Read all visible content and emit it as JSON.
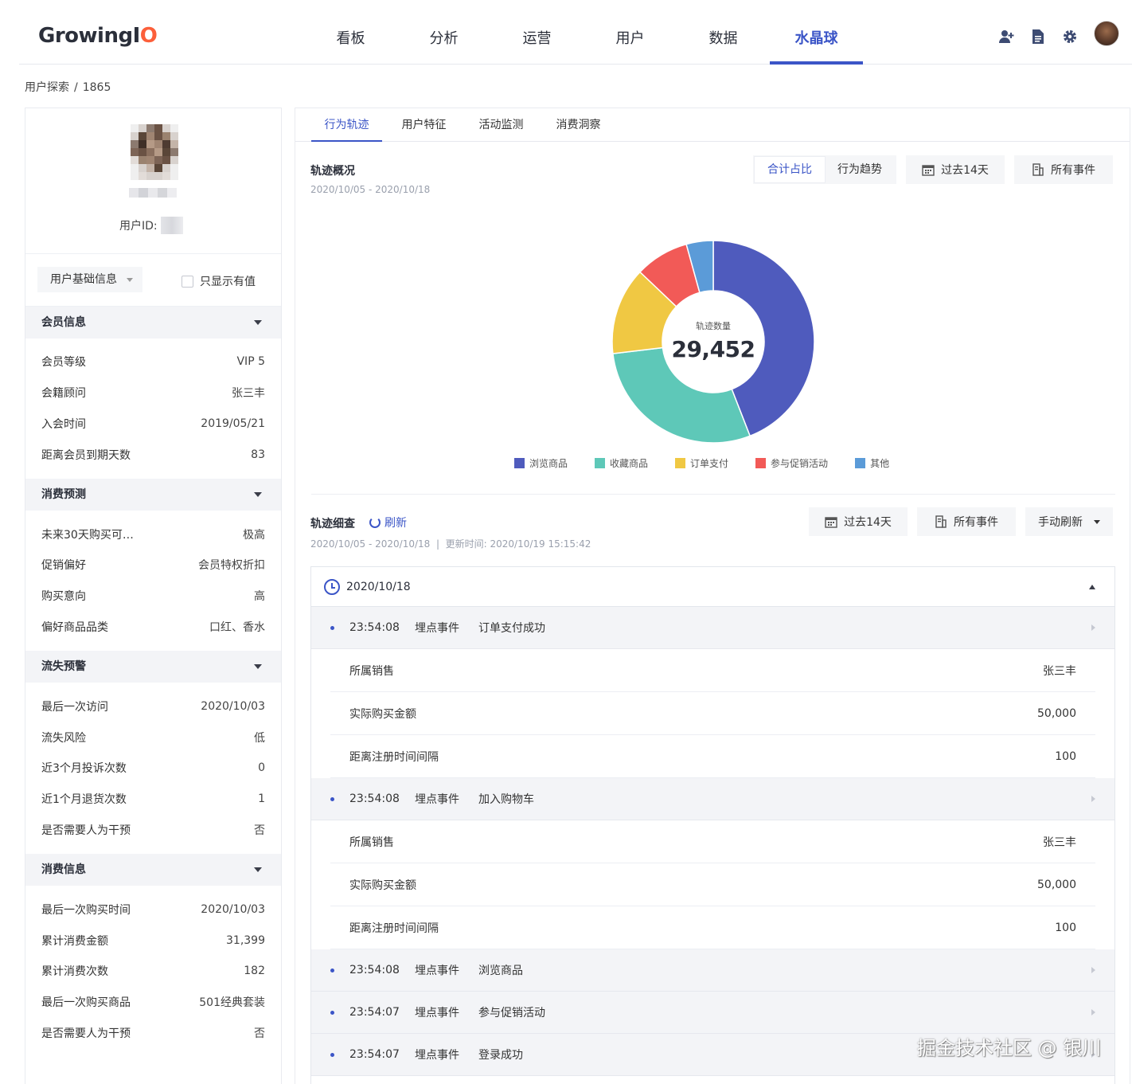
{
  "logo": {
    "prefix": "GrowingI",
    "suffix": "O"
  },
  "nav": [
    "看板",
    "分析",
    "运营",
    "用户",
    "数据",
    "水晶球"
  ],
  "nav_active": "水晶球",
  "breadcrumb": {
    "root": "用户探索",
    "sep": "/",
    "current": "1865"
  },
  "profile": {
    "uid_label": "用户ID:"
  },
  "filter": {
    "select_label": "用户基础信息",
    "checkbox_label": "只显示有值"
  },
  "sections": [
    {
      "title": "会员信息",
      "rows": [
        [
          "会员等级",
          "VIP 5"
        ],
        [
          "会籍顾问",
          "张三丰"
        ],
        [
          "入会时间",
          "2019/05/21"
        ],
        [
          "距离会员到期天数",
          "83"
        ]
      ]
    },
    {
      "title": "消费预测",
      "rows": [
        [
          "未来30天购买可…",
          "极高"
        ],
        [
          "促销偏好",
          "会员特权折扣"
        ],
        [
          "购买意向",
          "高"
        ],
        [
          "偏好商品品类",
          "口红、香水"
        ]
      ]
    },
    {
      "title": "流失预警",
      "rows": [
        [
          "最后一次访问",
          "2020/10/03"
        ],
        [
          "流失风险",
          "低"
        ],
        [
          "近3个月投诉次数",
          "0"
        ],
        [
          "近1个月退货次数",
          "1"
        ],
        [
          "是否需要人为干预",
          "否"
        ]
      ]
    },
    {
      "title": "消费信息",
      "rows": [
        [
          "最后一次购买时间",
          "2020/10/03"
        ],
        [
          "累计消费金额",
          "31,399"
        ],
        [
          "累计消费次数",
          "182"
        ],
        [
          "最后一次购买商品",
          "501经典套装"
        ],
        [
          "是否需要人为干预",
          "否"
        ]
      ]
    }
  ],
  "tabs": [
    "行为轨迹",
    "用户特征",
    "活动监测",
    "消费洞察"
  ],
  "overview": {
    "title": "轨迹概况",
    "date": "2020/10/05 - 2020/10/18",
    "seg": [
      "合计占比",
      "行为趋势"
    ],
    "range_btn": "过去14天",
    "events_btn": "所有事件",
    "center_label": "轨迹数量",
    "center_value": "29,452"
  },
  "chart_data": {
    "type": "pie",
    "donut": true,
    "center_label": "轨迹数量",
    "center_value": "29,452",
    "series": [
      {
        "name": "浏览商品",
        "value": 41,
        "color": "#4f5bbd"
      },
      {
        "name": "收藏商品",
        "value": 27,
        "color": "#5ec8b8"
      },
      {
        "name": "订单支付",
        "value": 13,
        "color": "#f0c843"
      },
      {
        "name": "参与促销活动",
        "value": 8,
        "color": "#f25a57"
      },
      {
        "name": "其他",
        "value": 4,
        "color": "#5b9bd8"
      }
    ]
  },
  "detail": {
    "title": "轨迹细查",
    "refresh": "刷新",
    "date": "2020/10/05 - 2020/10/18",
    "sep": "|",
    "updated": "更新时间: 2020/10/19 15:15:42",
    "range_btn": "过去14天",
    "events_btn": "所有事件",
    "manual_btn": "手动刷新",
    "day": "2020/10/18",
    "events": [
      {
        "time": "23:54:08",
        "kind": "埋点事件",
        "name": "订单支付成功",
        "props": [
          [
            "所属销售",
            "张三丰"
          ],
          [
            "实际购买金额",
            "50,000"
          ],
          [
            "距离注册时间间隔",
            "100"
          ]
        ]
      },
      {
        "time": "23:54:08",
        "kind": "埋点事件",
        "name": "加入购物车",
        "props": [
          [
            "所属销售",
            "张三丰"
          ],
          [
            "实际购买金额",
            "50,000"
          ],
          [
            "距离注册时间间隔",
            "100"
          ]
        ]
      },
      {
        "time": "23:54:08",
        "kind": "埋点事件",
        "name": "浏览商品",
        "props": []
      },
      {
        "time": "23:54:07",
        "kind": "埋点事件",
        "name": "参与促销活动",
        "props": []
      },
      {
        "time": "23:54:07",
        "kind": "埋点事件",
        "name": "登录成功",
        "props": []
      }
    ]
  },
  "watermark": "掘金技术社区 @ 银川"
}
